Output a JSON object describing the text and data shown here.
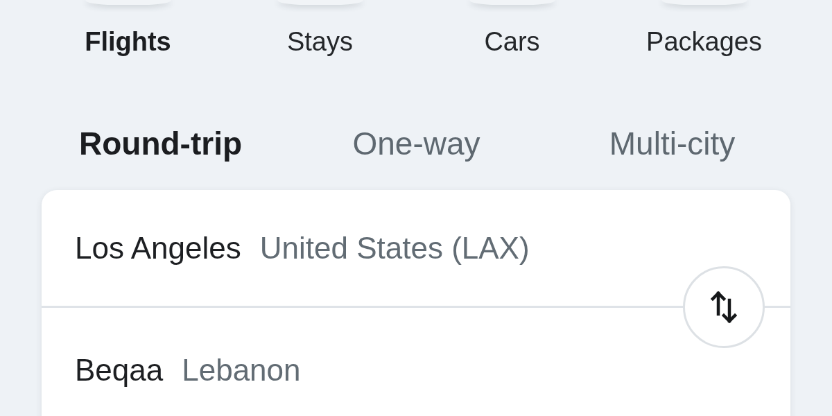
{
  "categories": [
    {
      "label": "Flights",
      "selected": true
    },
    {
      "label": "Stays",
      "selected": false
    },
    {
      "label": "Cars",
      "selected": false
    },
    {
      "label": "Packages",
      "selected": false
    }
  ],
  "trip_types": [
    {
      "label": "Round-trip",
      "selected": true
    },
    {
      "label": "One-way",
      "selected": false
    },
    {
      "label": "Multi-city",
      "selected": false
    }
  ],
  "route": [
    {
      "kind": "origin",
      "city": "Los Angeles",
      "detail": "United States (LAX)"
    },
    {
      "kind": "destination",
      "city": "Beqaa",
      "detail": "Lebanon"
    }
  ]
}
